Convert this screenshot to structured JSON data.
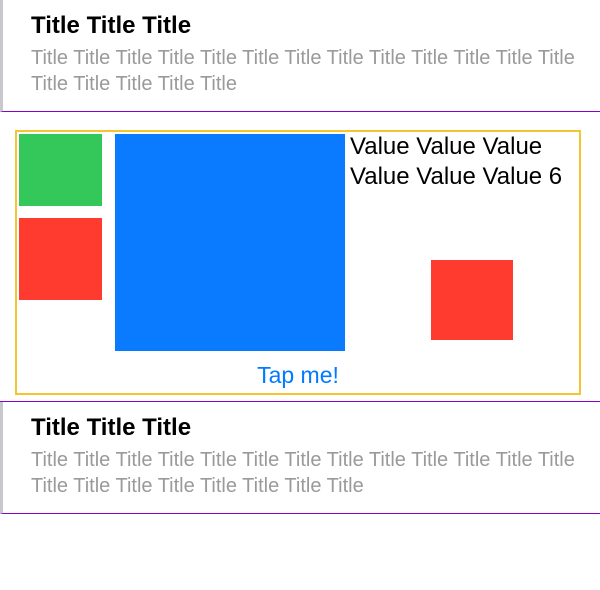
{
  "cells": [
    {
      "title": "Title Title Title",
      "subtitle": "Title Title Title  Title Title Title  Title Title Title  Title Title Title  Title Title Title  Title Title Title"
    },
    {
      "title": "Title Title Title",
      "subtitle": "Title Title Title  Title Title Title  Title Title Title  Title Title Title  Title Title Title  Title Title Title  Title Title Title"
    }
  ],
  "diagram": {
    "value_text": "Value Value Value Value Value Value 6",
    "button_label": "Tap me!",
    "colors": {
      "green": "#34c759",
      "blue": "#0a7bff",
      "red": "#ff3b30",
      "border": "#f4c531"
    }
  }
}
